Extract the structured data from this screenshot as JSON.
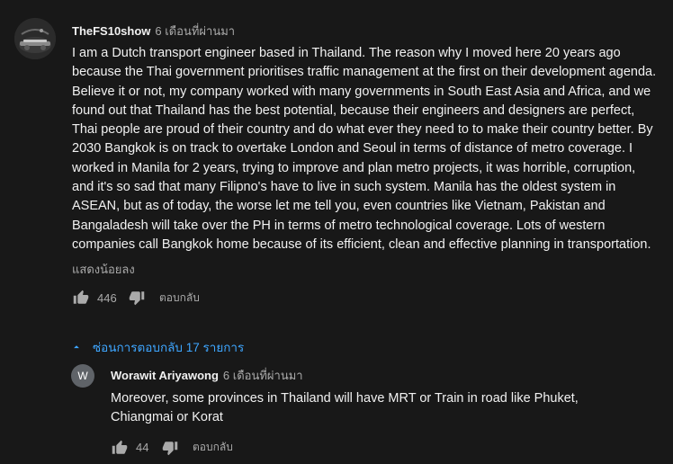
{
  "main_comment": {
    "author": "TheFS10show",
    "time": "6 เดือนที่ผ่านมา",
    "text": "I am a Dutch transport engineer based in Thailand. The reason why I moved here 20 years ago because the Thai government prioritises traffic management at the first on their development agenda. Believe it or not, my company worked with many governments in South East Asia and Africa, and we found out that Thailand has the best potential, because their engineers and designers are perfect, Thai people are proud of their country and do what ever they need to to make their country better. By 2030 Bangkok is on track to overtake London and Seoul in terms of distance of metro coverage. I worked in Manila for 2 years, trying to improve and plan metro projects, it was horrible, corruption, and it's so sad that many Filipno's have to live in such system. Manila has the oldest system in ASEAN, but as of today, the worse let me tell you, even countries like Vietnam, Pakistan and Bangaladesh will take over the PH in terms of metro technological coverage. Lots of western companies call Bangkok home because of its efficient, clean and effective planning in transportation.",
    "show_less": "แสดงน้อยลง",
    "likes": "446",
    "reply_label": "ตอบกลับ"
  },
  "replies_toggle": {
    "label": "ซ่อนการตอบกลับ 17 รายการ"
  },
  "reply": {
    "avatar_letter": "W",
    "author": "Worawit Ariyawong",
    "time": "6 เดือนที่ผ่านมา",
    "text": "Moreover, some provinces in Thailand will have MRT or Train in road like Phuket, Chiangmai or Korat",
    "likes": "44",
    "reply_label": "ตอบกลับ"
  },
  "colors": {
    "background": "#181818",
    "primary_text": "#f1f1f1",
    "secondary_text": "#aaaaaa",
    "link_blue": "#3ea6ff",
    "reply_avatar_bg": "#5f6368"
  }
}
